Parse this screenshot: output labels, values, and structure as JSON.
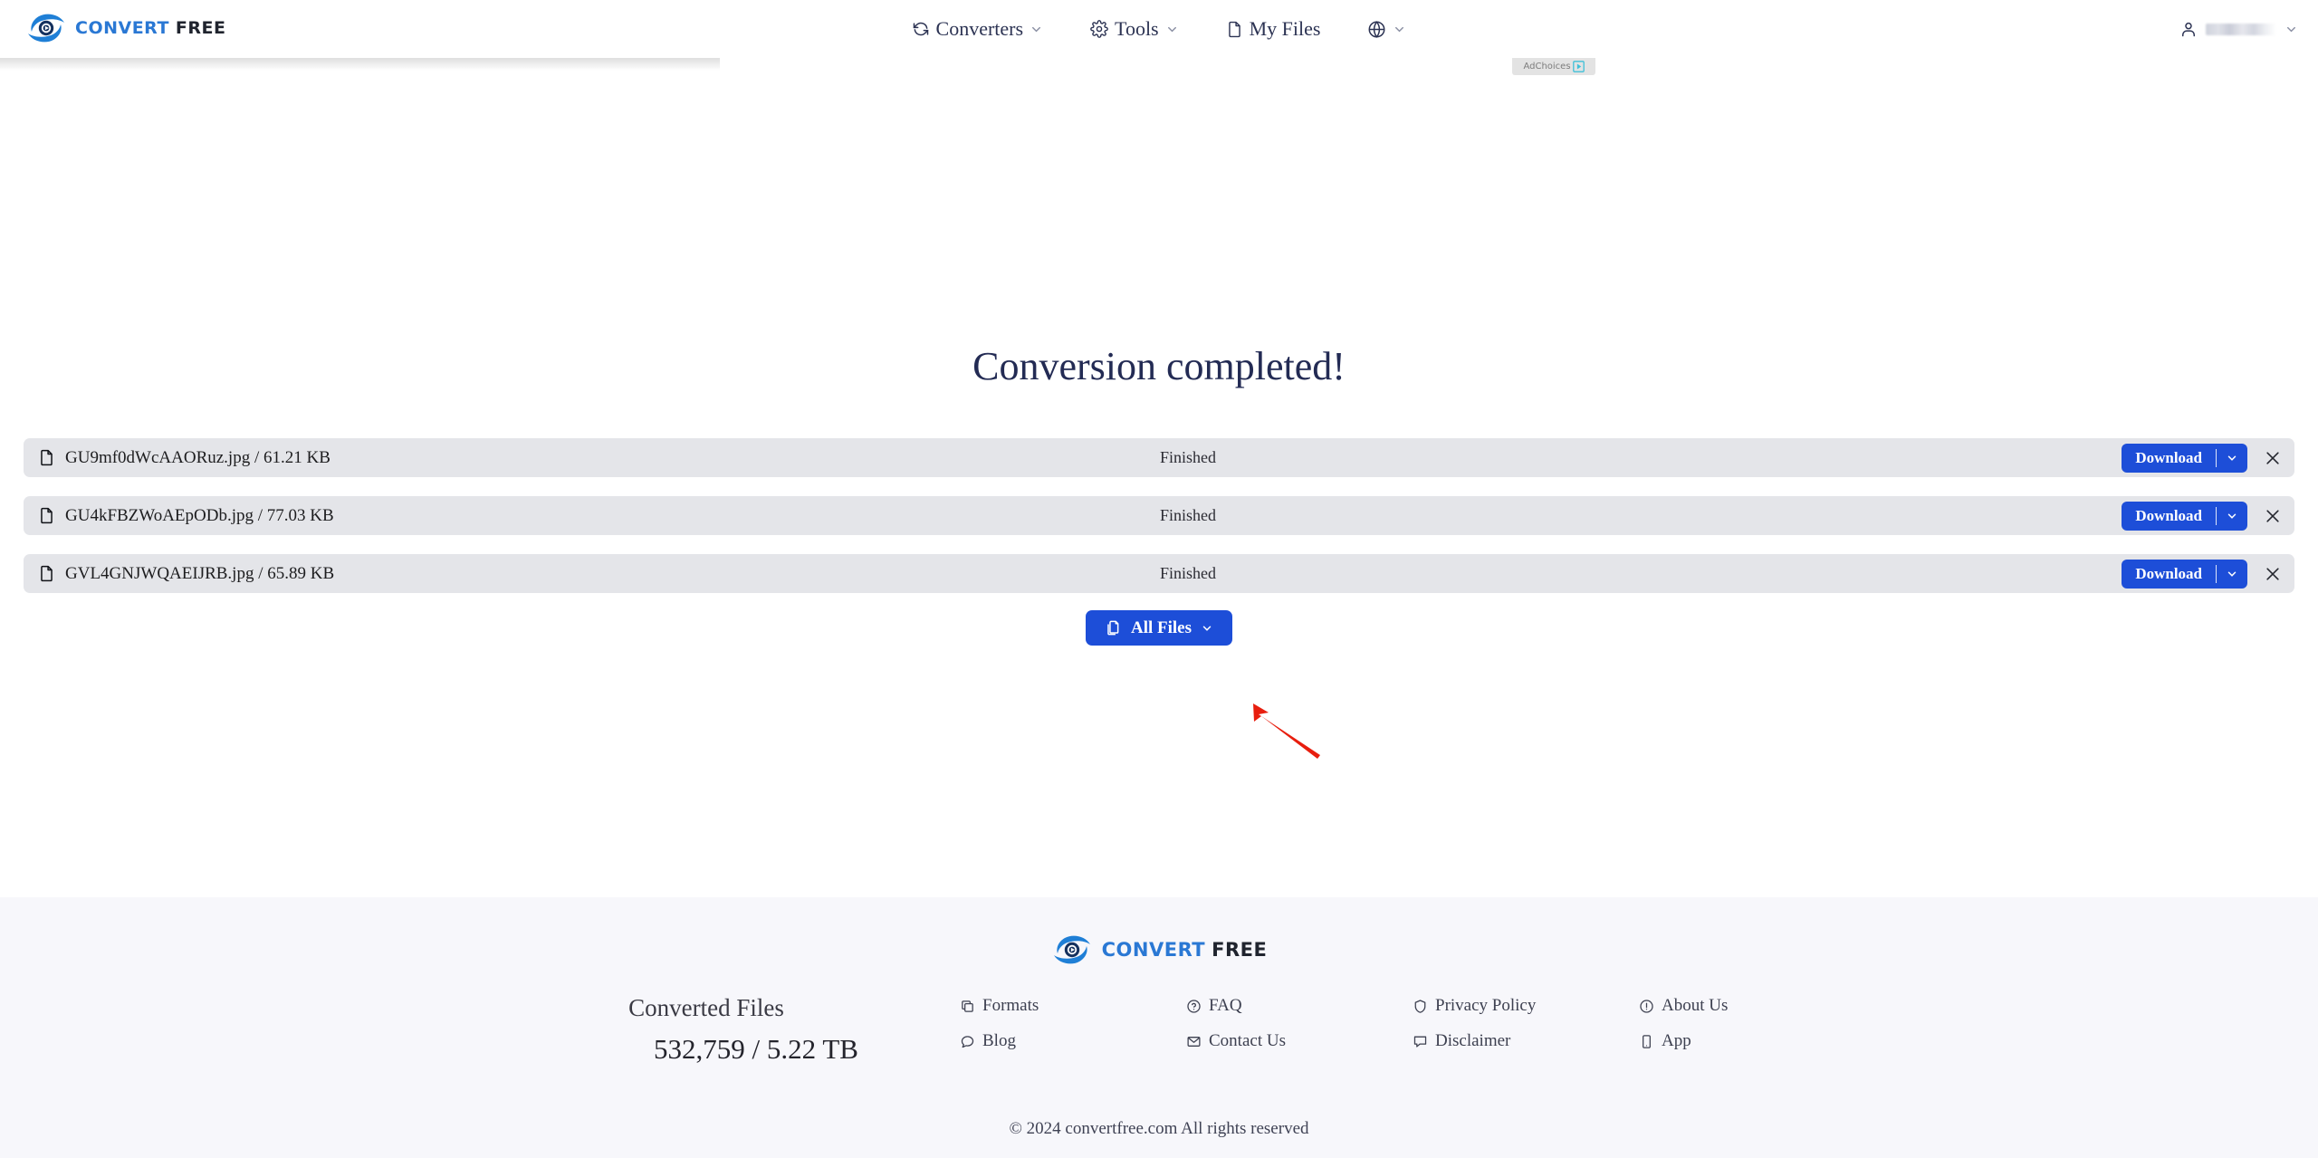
{
  "brand": {
    "name_primary": "CONVERT",
    "name_secondary": "FREE",
    "logo_icon": "convertfree-swirl-logo",
    "color_primary": "#2a78d4",
    "color_secondary": "#20242e"
  },
  "header": {
    "nav": [
      {
        "label": "Converters",
        "icon": "refresh-icon",
        "has_caret": true
      },
      {
        "label": "Tools",
        "icon": "gear-icon",
        "has_caret": true
      },
      {
        "label": "My Files",
        "icon": "file-icon",
        "has_caret": false
      },
      {
        "label": "",
        "icon": "globe-icon",
        "has_caret": true
      }
    ],
    "user": {
      "icon": "user-icon",
      "name": "",
      "redacted": true,
      "caret_icon": "chevron-down-icon"
    }
  },
  "ads": {
    "adchoices_label": "AdChoices",
    "adchoices_icon": "adchoices-triangle-icon",
    "adchoices_color": "#3fc0d8"
  },
  "main": {
    "title": "Conversion completed!",
    "status_column_label": "Finished",
    "download_label": "Download",
    "download_caret_icon": "chevron-down-icon",
    "remove_icon": "close-icon",
    "file_icon": "file-icon",
    "accent_color": "#1d4ed8",
    "row_background": "#e4e5e9",
    "files": [
      {
        "name": "GU9mf0dWcAAORuz.jpg",
        "size": "61.21 KB",
        "display": "GU9mf0dWcAAORuz.jpg / 61.21 KB",
        "status": "Finished"
      },
      {
        "name": "GU4kFBZWoAEpODb.jpg",
        "size": "77.03 KB",
        "display": "GU4kFBZWoAEpODb.jpg / 77.03 KB",
        "status": "Finished"
      },
      {
        "name": "GVL4GNJWQAEIJRB.jpg",
        "size": "65.89 KB",
        "display": "GVL4GNJWQAEIJRB.jpg / 65.89 KB",
        "status": "Finished"
      }
    ],
    "all_files_button": {
      "label": "All Files",
      "icon": "copy-files-icon",
      "caret_icon": "chevron-down-icon"
    },
    "annotation": {
      "type": "arrow",
      "color": "#e81e0e",
      "points_to": "all-files-button"
    }
  },
  "footer": {
    "stats": {
      "title": "Converted Files",
      "value": "532,759 / 5.22 TB"
    },
    "columns": [
      [
        {
          "label": "Formats",
          "icon": "copy-icon"
        },
        {
          "label": "Blog",
          "icon": "speech-bubble-icon"
        }
      ],
      [
        {
          "label": "FAQ",
          "icon": "question-circle-icon"
        },
        {
          "label": "Contact Us",
          "icon": "envelope-icon"
        }
      ],
      [
        {
          "label": "Privacy Policy",
          "icon": "shield-icon"
        },
        {
          "label": "Disclaimer",
          "icon": "chat-icon"
        }
      ],
      [
        {
          "label": "About Us",
          "icon": "info-circle-icon"
        },
        {
          "label": "App",
          "icon": "mobile-icon"
        }
      ]
    ],
    "copyright": "© 2024 convertfree.com All rights reserved"
  }
}
